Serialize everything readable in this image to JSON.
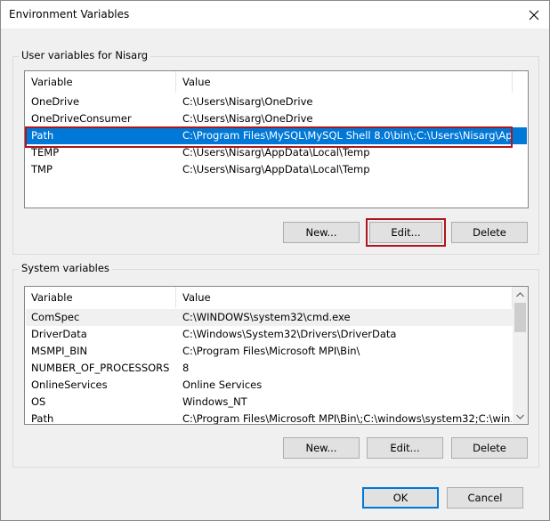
{
  "window": {
    "title": "Environment Variables",
    "close_icon": "close-icon"
  },
  "user_vars": {
    "group_label": "User variables for Nisarg",
    "columns": [
      "Variable",
      "Value"
    ],
    "rows": [
      {
        "variable": "OneDrive",
        "value": "C:\\Users\\Nisarg\\OneDrive"
      },
      {
        "variable": "OneDriveConsumer",
        "value": "C:\\Users\\Nisarg\\OneDrive"
      },
      {
        "variable": "Path",
        "value": "C:\\Program Files\\MySQL\\MySQL Shell 8.0\\bin\\;C:\\Users\\Nisarg\\Ap..."
      },
      {
        "variable": "TEMP",
        "value": "C:\\Users\\Nisarg\\AppData\\Local\\Temp"
      },
      {
        "variable": "TMP",
        "value": "C:\\Users\\Nisarg\\AppData\\Local\\Temp"
      }
    ],
    "selected_row": "Path",
    "buttons": {
      "new": "New...",
      "edit": "Edit...",
      "delete": "Delete"
    }
  },
  "system_vars": {
    "group_label": "System variables",
    "columns": [
      "Variable",
      "Value"
    ],
    "rows": [
      {
        "variable": "ComSpec",
        "value": "C:\\WINDOWS\\system32\\cmd.exe"
      },
      {
        "variable": "DriverData",
        "value": "C:\\Windows\\System32\\Drivers\\DriverData"
      },
      {
        "variable": "MSMPI_BIN",
        "value": "C:\\Program Files\\Microsoft MPI\\Bin\\"
      },
      {
        "variable": "NUMBER_OF_PROCESSORS",
        "value": "8"
      },
      {
        "variable": "OnlineServices",
        "value": "Online Services"
      },
      {
        "variable": "OS",
        "value": "Windows_NT"
      },
      {
        "variable": "Path",
        "value": "C:\\Program Files\\Microsoft MPI\\Bin\\;C:\\windows\\system32;C:\\win..."
      }
    ],
    "buttons": {
      "new": "New...",
      "edit": "Edit...",
      "delete": "Delete"
    }
  },
  "footer": {
    "ok": "OK",
    "cancel": "Cancel"
  },
  "colors": {
    "selection": "#0078d7",
    "highlight_outline": "#b0151d"
  }
}
